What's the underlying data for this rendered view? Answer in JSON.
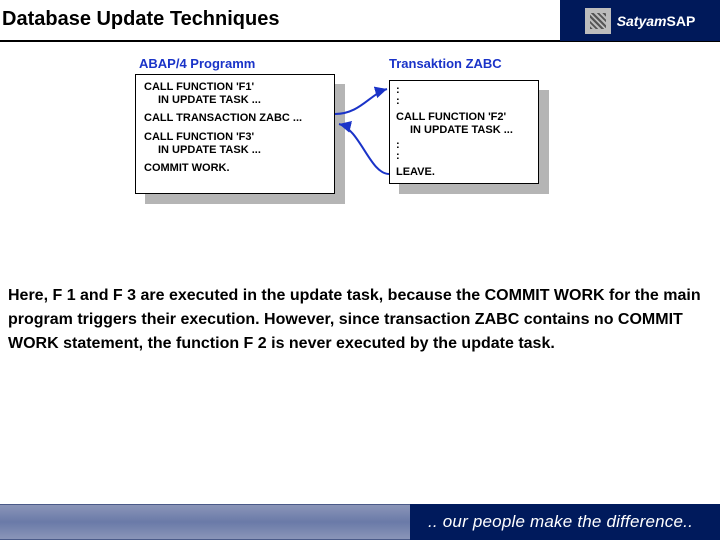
{
  "header": {
    "title": "Database Update Techniques",
    "brand_main": "Satyam",
    "brand_sub": "SAP"
  },
  "diagram": {
    "left_label": "ABAP/4 Programm",
    "right_label": "Transaktion ZABC",
    "left_code": {
      "l1": "CALL FUNCTION 'F1'",
      "l1b": "IN UPDATE TASK ...",
      "l2": "CALL TRANSACTION ZABC ...",
      "l3": "CALL FUNCTION 'F3'",
      "l3b": "IN UPDATE TASK ...",
      "l4": "COMMIT WORK."
    },
    "right_code": {
      "d1": ":",
      "d2": ":",
      "l1": "CALL FUNCTION 'F2'",
      "l1b": "IN UPDATE TASK ...",
      "d3": ":",
      "d4": ":",
      "l2": "LEAVE."
    }
  },
  "body": {
    "text": "Here, F 1 and F 3 are executed in the update task, because the COMMIT WORK for the main program triggers their execution. However, since transaction ZABC contains no COMMIT WORK statement, the function F 2 is never executed by the update task."
  },
  "footer": {
    "tagline": ".. our people make the difference.."
  }
}
